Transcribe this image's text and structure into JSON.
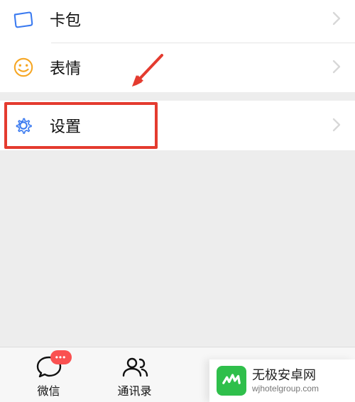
{
  "menu": {
    "cards": {
      "label": "卡包"
    },
    "sticker": {
      "label": "表情"
    },
    "settings": {
      "label": "设置"
    }
  },
  "colors": {
    "accent_blue": "#3a7af0",
    "accent_orange": "#f6a623",
    "highlight_red": "#e43b2f",
    "badge_red": "#fa5151",
    "wm_green": "#2fbf4b"
  },
  "tabbar": {
    "chats": {
      "label": "微信",
      "badge": "•••"
    },
    "contacts": {
      "label": "通讯录"
    },
    "discover": {
      "label": ""
    },
    "me": {
      "label": ""
    }
  },
  "watermark": {
    "title": "无极安卓网",
    "subtitle": "wjhotelgroup.com"
  }
}
